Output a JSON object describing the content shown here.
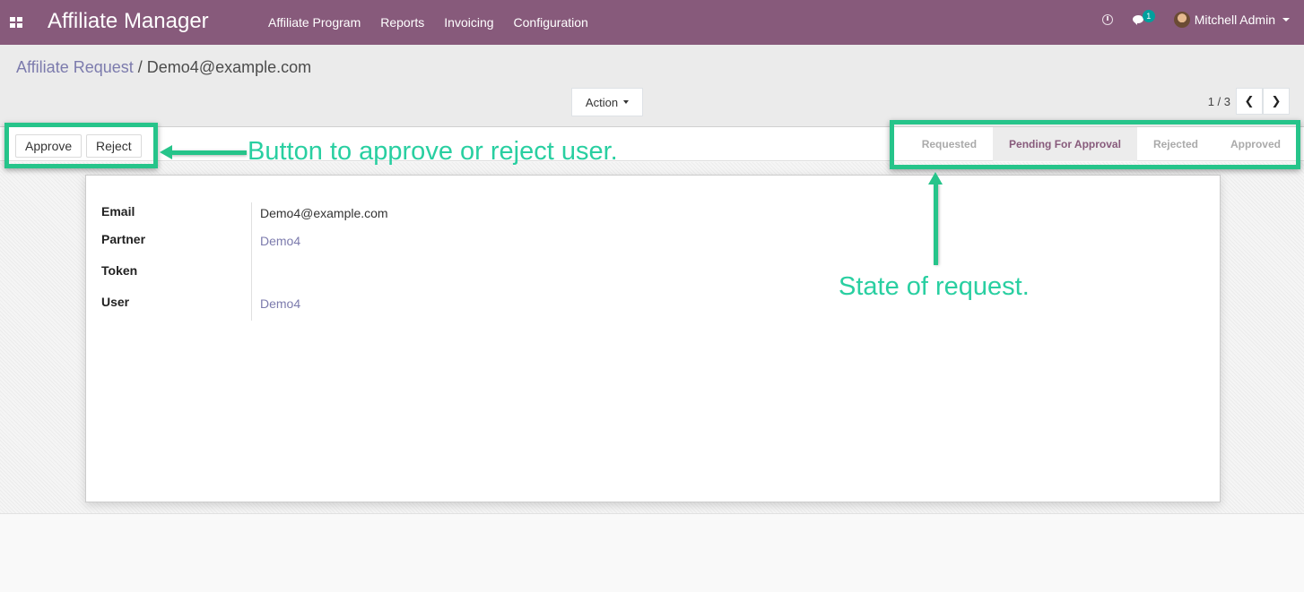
{
  "navbar": {
    "brand": "Affiliate Manager",
    "menu": [
      "Affiliate Program",
      "Reports",
      "Invoicing",
      "Configuration"
    ],
    "chat_count": "1",
    "user": "Mitchell Admin",
    "icons": [
      "apps-grid-icon",
      "clock-icon",
      "chat-icon",
      "user-avatar"
    ]
  },
  "breadcrumb": {
    "parent": "Affiliate Request",
    "separator": "/",
    "current": "Demo4@example.com"
  },
  "toolbar": {
    "action_label": "Action",
    "pager": "1 / 3"
  },
  "header": {
    "buttons": [
      "Approve",
      "Reject"
    ],
    "stages": [
      "Requested",
      "Pending For Approval",
      "Rejected",
      "Approved"
    ],
    "active_stage": "Pending For Approval"
  },
  "form": {
    "fields": [
      {
        "label": "Email",
        "value": "Demo4@example.com"
      },
      {
        "label": "Partner",
        "value": "Demo4"
      },
      {
        "label": "Token",
        "value": ""
      },
      {
        "label": "User",
        "value": "Demo4"
      }
    ]
  },
  "annotations": {
    "buttons_note": "Button to approve or reject user.",
    "state_note": "State of request."
  },
  "colors": {
    "brand": "#875a7b",
    "link": "#7c7bad",
    "annotation": "#26c48a",
    "badge": "#00a09d"
  }
}
